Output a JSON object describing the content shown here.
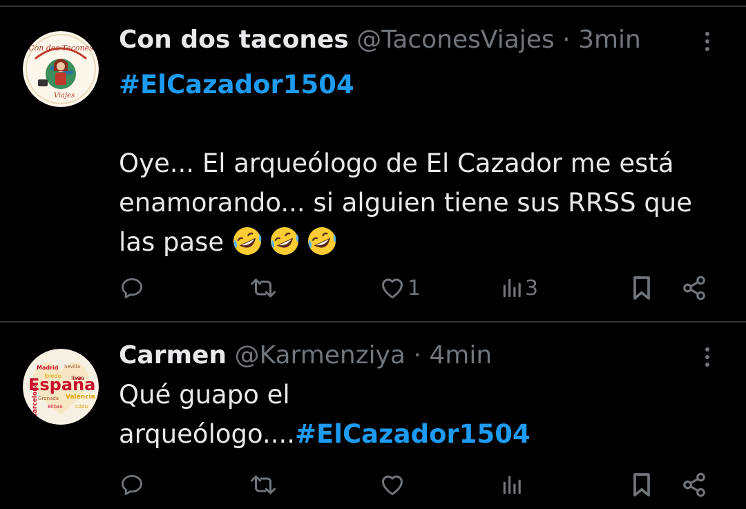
{
  "tweets": [
    {
      "display_name": "Con dos tacones",
      "handle": "@TaconesViajes",
      "separator": "·",
      "time": "3min",
      "hashtag": "#ElCazador1504",
      "text_line_1": "Oye... El arqueólogo de El Cazador me está",
      "text_line_2": "enamorando... si alguien tiene sus RRSS que",
      "text_line_3": "las pase",
      "emojis": [
        "rolling-on-floor-laughing-emoji",
        "rolling-on-floor-laughing-emoji",
        "rolling-on-floor-laughing-emoji"
      ],
      "avatar_icon": "con-dos-tacones-logo",
      "avatar_colors": {
        "ring": "#c0392b",
        "bg": "#fdf6ea",
        "globe": "#3a8f5c"
      },
      "likes": "1",
      "views": "3"
    },
    {
      "display_name": "Carmen",
      "handle": "@Karmenziya",
      "separator": "·",
      "time": "4min",
      "text_line_1": "Qué guapo el",
      "text_line_2": "arqueólogo....",
      "hashtag": "#ElCazador1504",
      "avatar_icon": "espana-word-cloud",
      "avatar_colors": {
        "red": "#c8102e",
        "yellow": "#f1bf00",
        "bg": "#f7f1e3"
      }
    }
  ],
  "icons": {
    "reply": "reply-icon",
    "retweet": "retweet-icon",
    "like": "heart-icon",
    "views": "views-icon",
    "bookmark": "bookmark-icon",
    "share": "share-icon",
    "more": "more-vertical-icon"
  },
  "colors": {
    "background": "#000000",
    "text": "#e7e9ea",
    "muted": "#71767b",
    "accent": "#1d9bf0",
    "divider": "#2f3336"
  }
}
